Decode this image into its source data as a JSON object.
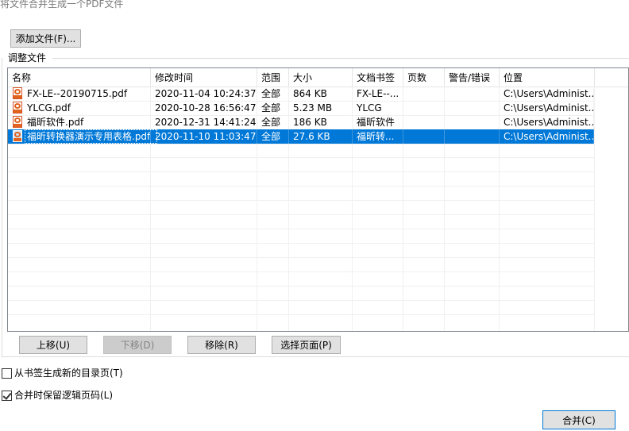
{
  "window": {
    "title": "将文件合并生成一个PDF文件"
  },
  "toolbar": {
    "add_file_label": "添加文件(F)..."
  },
  "group": {
    "label": "调整文件"
  },
  "table": {
    "columns": [
      "名称",
      "修改时间",
      "范围",
      "大小",
      "文档书签",
      "页数",
      "警告/错误",
      "位置"
    ],
    "rows": [
      {
        "name": "FX-LE--20190715.pdf",
        "modified": "2020-11-04 10:24:37",
        "range": "全部",
        "size": "864 KB",
        "bookmark": "FX-LE--...",
        "pages": "",
        "warning": "",
        "location": "C:\\Users\\Administ...",
        "selected": false
      },
      {
        "name": "YLCG.pdf",
        "modified": "2020-10-28 16:56:47",
        "range": "全部",
        "size": "5.23 MB",
        "bookmark": "YLCG",
        "pages": "",
        "warning": "",
        "location": "C:\\Users\\Administ...",
        "selected": false
      },
      {
        "name": "福昕软件.pdf",
        "modified": "2020-12-31 14:41:24",
        "range": "全部",
        "size": "186 KB",
        "bookmark": "福昕软件",
        "pages": "",
        "warning": "",
        "location": "C:\\Users\\Administ...",
        "selected": false
      },
      {
        "name": "福昕转换器演示专用表格.pdf",
        "modified": "2020-11-10 11:03:47",
        "range": "全部",
        "size": "27.6 KB",
        "bookmark": "福昕转...",
        "pages": "",
        "warning": "",
        "location": "C:\\Users\\Administ...",
        "selected": true
      }
    ]
  },
  "actions": {
    "move_up": "上移(U)",
    "move_down": "下移(D)",
    "remove": "移除(R)",
    "select_pages": "选择页面(P)"
  },
  "options": {
    "toc_from_bookmarks": {
      "label": "从书签生成新的目录页(T)",
      "checked": false
    },
    "keep_logical_page_numbers": {
      "label": "合并时保留逻辑页码(L)",
      "checked": true
    }
  },
  "footer": {
    "merge_label": "合并(C)"
  },
  "colors": {
    "selection": "#0078d7",
    "pdf_icon": "#e0631e"
  },
  "icons": {
    "file": "pdf-file-icon"
  }
}
